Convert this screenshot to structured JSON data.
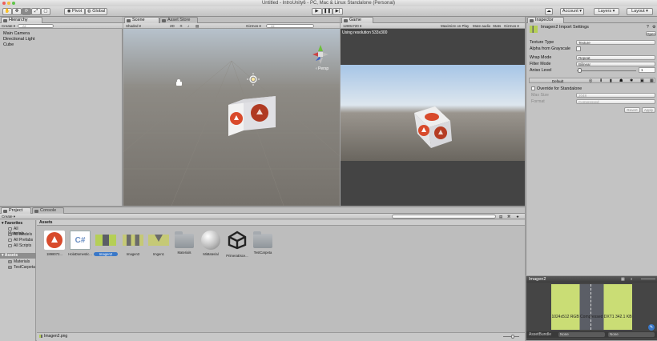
{
  "window": {
    "title": "Untitled - IntroUnity6 - PC, Mac & Linux Standalone (Personal)"
  },
  "toolbar": {
    "pivot": "Pivot",
    "global": "Global",
    "account": "Account",
    "layers": "Layers",
    "layout": "Layout"
  },
  "hierarchy": {
    "tab": "Hierarchy",
    "create": "Create",
    "search_placeholder": "All",
    "items": [
      "Main Camera",
      "Directional Light",
      "Cube"
    ]
  },
  "scene": {
    "tab": "Scene",
    "asset_store_tab": "Asset Store",
    "shading": "Shaded",
    "mode_2d": "2D",
    "gizmos": "Gizmos",
    "search_placeholder": "All",
    "persp": "‹ Persp"
  },
  "game": {
    "tab": "Game",
    "resolution": "1280x720",
    "using_resolution": "Using resolution 533x300",
    "maximize": "Maximize on Play",
    "mute": "Mute audio",
    "stats": "Stats",
    "gizmos": "Gizmos"
  },
  "inspector": {
    "tab": "Inspector",
    "asset_name": "Imagen2",
    "import_settings": "Import Settings",
    "open": "Open",
    "texture_type_label": "Texture Type",
    "texture_type_value": "Texture",
    "alpha_label": "Alpha from Grayscale",
    "wrap_label": "Wrap Mode",
    "wrap_value": "Repeat",
    "filter_label": "Filter Mode",
    "filter_value": "Bilinear",
    "aniso_label": "Aniso Level",
    "aniso_value": "1",
    "default_tab": "Default",
    "override_label": "Override for Standalone",
    "max_size_label": "Max Size",
    "max_size_value": "2048",
    "format_label": "Format",
    "format_value": "Compressed",
    "revert": "Revert",
    "apply": "Apply"
  },
  "preview": {
    "title": "Imagen2",
    "info": "1024x512 RGB Compressed DXT1 342.1 KB",
    "assetbundle_label": "AssetBundle",
    "assetbundle_value": "None",
    "assetbundle_variant": "None"
  },
  "project": {
    "tab": "Project",
    "console_tab": "Console",
    "create": "Create",
    "favorites": "Favorites",
    "favorite_items": [
      "All Materials",
      "All Models",
      "All Prefabs",
      "All Scripts"
    ],
    "assets_root": "Assets",
    "asset_folders": [
      "Materials",
      "TestCarpeta"
    ],
    "breadcrumb": "Assets",
    "assets": [
      {
        "label": "1898072...",
        "kind": "image-red"
      },
      {
        "label": "HolaDomestic...",
        "kind": "script"
      },
      {
        "label": "Imagen2",
        "kind": "image-green",
        "selected": true
      },
      {
        "label": "Imagen3",
        "kind": "image-yellow"
      },
      {
        "label": "Imgen1",
        "kind": "image-y"
      },
      {
        "label": "Materials",
        "kind": "folder"
      },
      {
        "label": "MiMaterial",
        "kind": "material"
      },
      {
        "label": "PrimeraEsce...",
        "kind": "unity"
      },
      {
        "label": "TestCarpeta",
        "kind": "folder"
      }
    ],
    "status_file": "Imagen2.png"
  }
}
